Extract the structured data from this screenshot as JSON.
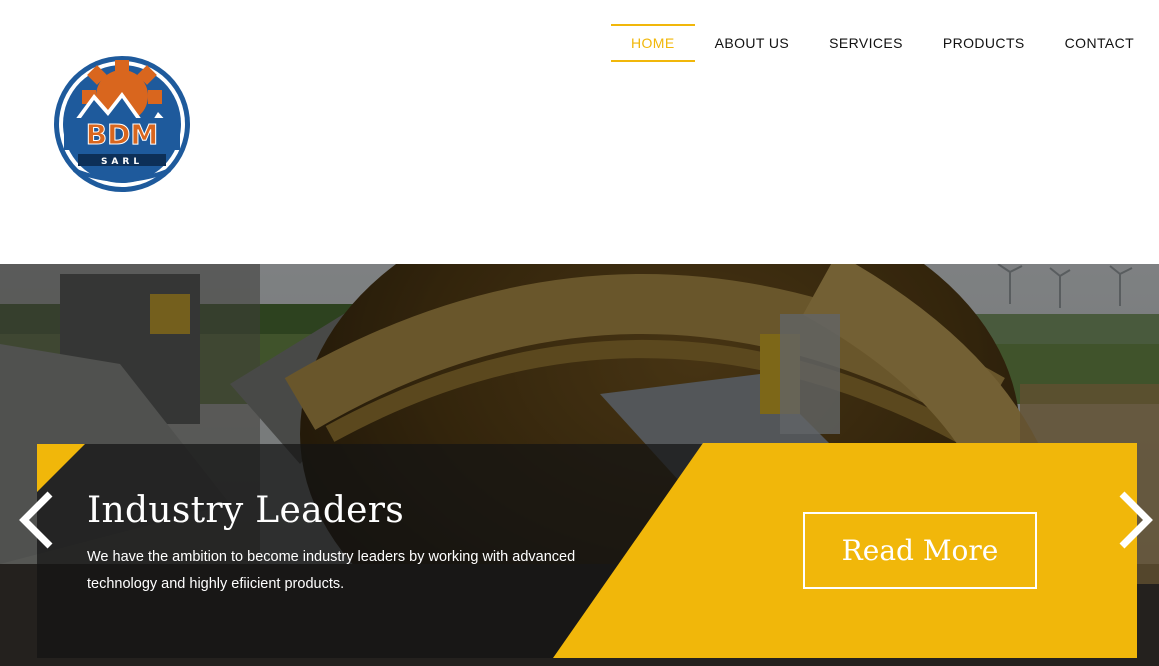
{
  "logo": {
    "text": "BDM",
    "subtext": "SARL"
  },
  "nav": {
    "items": [
      {
        "label": "HOME",
        "active": true
      },
      {
        "label": "ABOUT US",
        "active": false
      },
      {
        "label": "SERVICES",
        "active": false
      },
      {
        "label": "PRODUCTS",
        "active": false
      },
      {
        "label": "CONTACT",
        "active": false
      }
    ]
  },
  "hero": {
    "title": "Industry Leaders",
    "text": "We have the ambition to become industry leaders by working with advanced technology and highly efiicient products.",
    "button_label": "Read More",
    "prev_icon": "chevron-left-icon",
    "next_icon": "chevron-right-icon"
  },
  "colors": {
    "accent": "#f1b70a",
    "logo_blue": "#1e5a9c",
    "logo_orange": "#d9661e"
  }
}
